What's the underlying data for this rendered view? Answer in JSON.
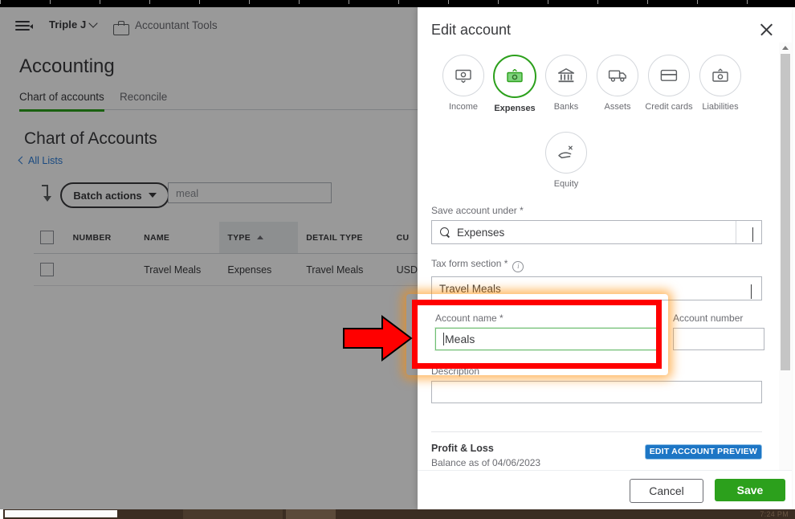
{
  "app": {
    "topbar": {
      "hamburger_icon": "hamburger-menu-icon",
      "company_name": "Triple J",
      "company_chevron_icon": "chevron-down-icon",
      "accountant_tools_icon": "briefcase-icon",
      "accountant_tools_label": "Accountant Tools"
    },
    "page_title": "Accounting",
    "tabs": [
      {
        "label": "Chart of accounts",
        "active": true
      },
      {
        "label": "Reconcile",
        "active": false
      }
    ],
    "list": {
      "heading": "Chart of Accounts",
      "back_link": "All Lists",
      "back_chevron_icon": "chevron-left-icon",
      "sort_icon": "sort-descending-icon",
      "batch_actions_label": "Batch actions",
      "batch_actions_caret_icon": "caret-down-icon",
      "filter_value": "meal",
      "columns": [
        "NUMBER",
        "NAME",
        "TYPE",
        "DETAIL TYPE",
        "CU"
      ],
      "sorted_column": "TYPE",
      "sort_direction_icon": "caret-up-icon",
      "rows": [
        {
          "number": "",
          "name": "Travel Meals",
          "type": "Expenses",
          "detail_type": "Travel Meals",
          "currency": "USD"
        }
      ]
    }
  },
  "modal": {
    "title": "Edit account",
    "close_icon": "close-x-icon",
    "account_types": [
      {
        "label": "Income",
        "icon": "money-in-icon",
        "selected": false
      },
      {
        "label": "Expenses",
        "icon": "money-out-icon",
        "selected": true
      },
      {
        "label": "Banks",
        "icon": "bank-building-icon",
        "selected": false
      },
      {
        "label": "Assets",
        "icon": "delivery-truck-icon",
        "selected": false
      },
      {
        "label": "Credit cards",
        "icon": "credit-card-icon",
        "selected": false
      },
      {
        "label": "Liabilities",
        "icon": "money-bill-icon",
        "selected": false
      }
    ],
    "equity_type": {
      "label": "Equity",
      "icon": "equity-hand-icon",
      "selected": false
    },
    "fields": {
      "save_account_under": {
        "label": "Save account under *",
        "value": "Expenses",
        "search_icon": "magnifier-icon",
        "chevron_icon": "chevron-down-icon"
      },
      "tax_form_section": {
        "label": "Tax form section *",
        "info_icon": "info-circle-icon",
        "value": "Travel Meals",
        "chevron_icon": "chevron-down-icon"
      },
      "account_name": {
        "label": "Account name *",
        "value": "Meals",
        "placeholder": ""
      },
      "account_number": {
        "label": "Account number",
        "value": "",
        "placeholder": ""
      },
      "description": {
        "label": "Description",
        "value": "",
        "placeholder": ""
      }
    },
    "preview": {
      "title": "Profit & Loss",
      "subtitle": "Balance as of 04/06/2023",
      "badge": "EDIT ACCOUNT PREVIEW"
    },
    "footer": {
      "cancel_label": "Cancel",
      "save_label": "Save"
    },
    "scrollbar": {
      "up_arrow_icon": "scroll-up-arrow-icon",
      "down_arrow_icon": "scroll-down-arrow-icon"
    }
  },
  "annotation": {
    "arrow_icon": "red-right-arrow-annotation",
    "highlight_color": "#ff0000",
    "glow_color": "#ff8c00",
    "target": "account_name"
  },
  "taskbar": {
    "clock": "7:24 PM"
  }
}
